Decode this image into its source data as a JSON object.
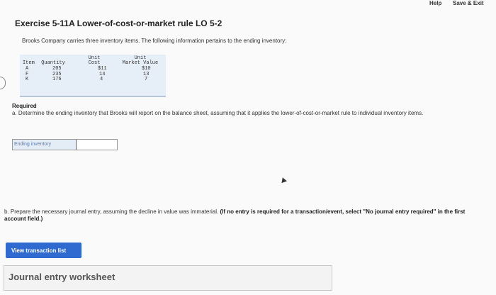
{
  "topbar": {
    "help": "Help",
    "save_exit": "Save & Exit"
  },
  "title": "Exercise 5-11A Lower-of-cost-or-market rule LO 5-2",
  "intro": "Brooks Company carries three inventory items. The following information pertains to the ending inventory:",
  "inventory_table": {
    "headers": {
      "item": "Item",
      "quantity": "Quantity",
      "unit_cost_line1": "Unit",
      "unit_cost_line2": "Cost",
      "unit_market_line1": "Unit",
      "unit_market_line2": "Market Value"
    },
    "rows": [
      {
        "item": "A",
        "quantity": "205",
        "cost": "$11",
        "market": "$10"
      },
      {
        "item": "F",
        "quantity": "235",
        "cost": "14",
        "market": "13"
      },
      {
        "item": "K",
        "quantity": "176",
        "cost": "4",
        "market": "7"
      }
    ]
  },
  "required": {
    "heading": "Required",
    "part_a": "a. Determine the ending inventory that Brooks will report on the balance sheet, assuming that it applies the lower-of-cost-or-market rule to individual inventory items.",
    "ending_inventory_label": "Ending inventory",
    "ending_inventory_value": "",
    "part_b": "b. Prepare the necessary journal entry, assuming the decline in value was immaterial.",
    "part_b_bold": "(If no entry is required for a transaction/event, select \"No journal entry required\" in the first account field.)"
  },
  "buttons": {
    "view_transaction_list": "View transaction list"
  },
  "journal_worksheet": {
    "title": "Journal entry worksheet"
  }
}
